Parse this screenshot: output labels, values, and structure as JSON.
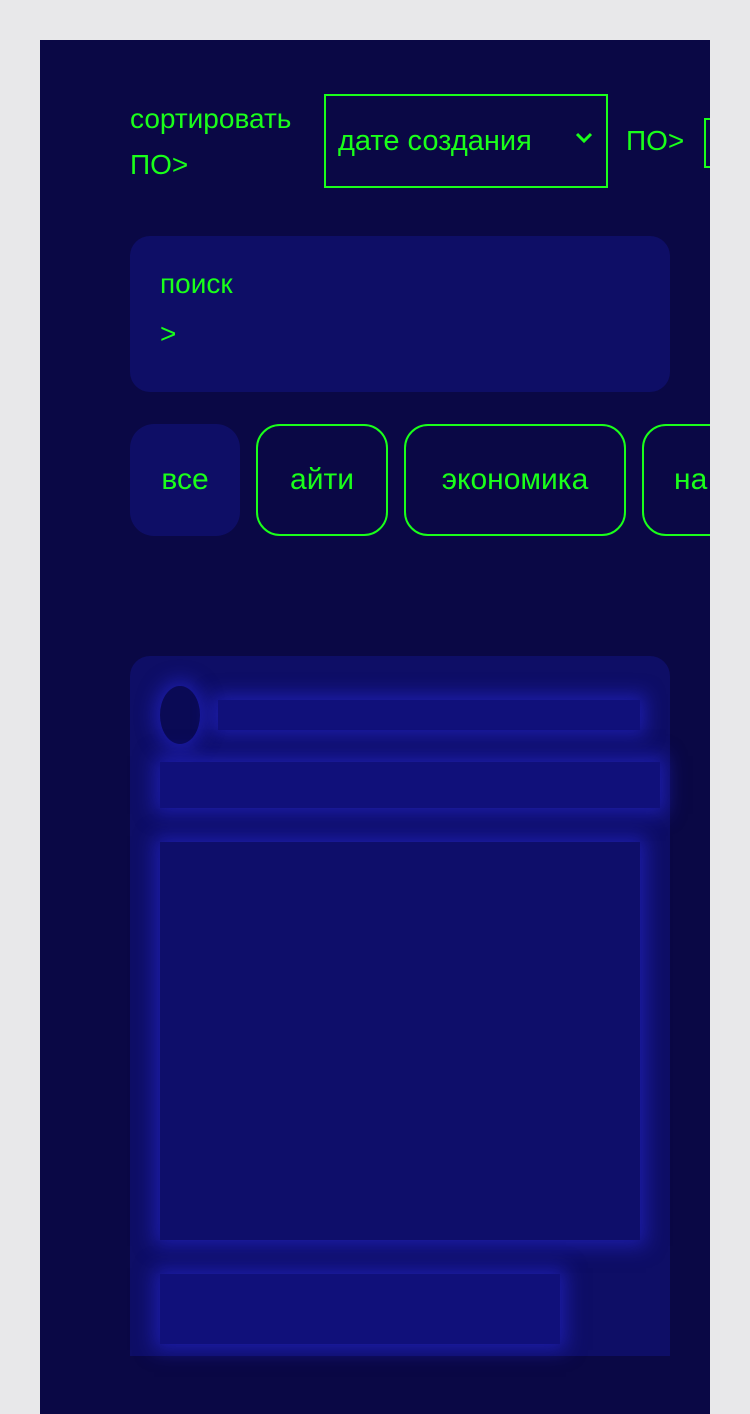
{
  "sort": {
    "label": "сортировать ПО>",
    "selected": "дате создания",
    "order_label": "ПО>"
  },
  "search": {
    "label": "поиск",
    "prompt": ">"
  },
  "filters": [
    {
      "label": "все",
      "active": true
    },
    {
      "label": "айти",
      "active": false
    },
    {
      "label": "экономика",
      "active": false
    },
    {
      "label": "на",
      "active": false
    }
  ],
  "colors": {
    "background": "#0a0845",
    "card": "#0e0e66",
    "accent": "#1aff1a",
    "skeleton_glow": "#2828dc"
  },
  "icons": {
    "select_chevron": "chevron-down-icon"
  }
}
